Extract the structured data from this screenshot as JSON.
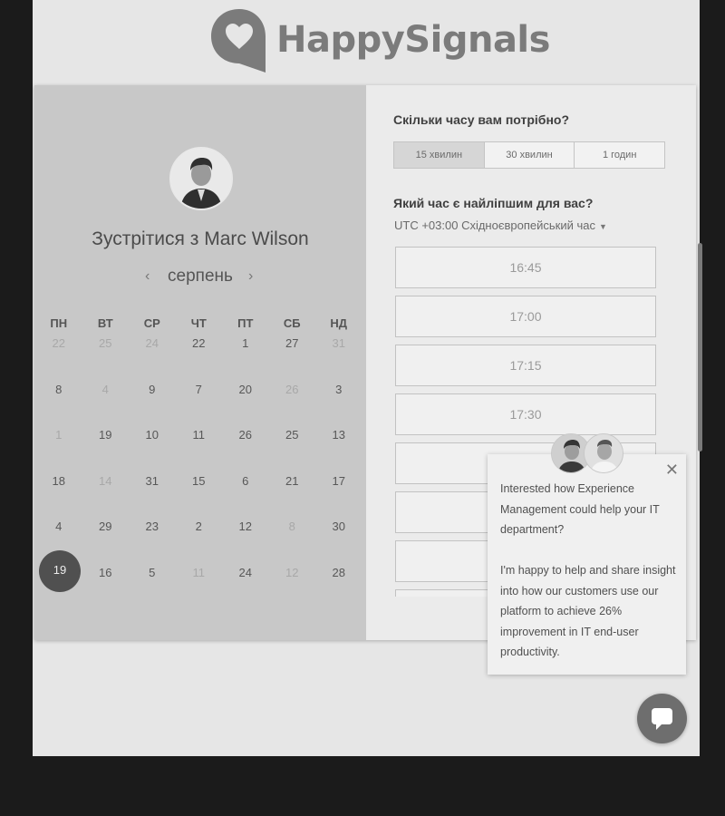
{
  "brand": {
    "name": "HappySignals",
    "icon": "heart-speech-bubble-icon"
  },
  "booking": {
    "title": "Зустрітися з Marc Wilson",
    "month": "серпень",
    "weekdays": [
      "ПН",
      "ВТ",
      "СР",
      "ЧТ",
      "ПТ",
      "СБ",
      "НД"
    ],
    "days": [
      [
        {
          "v": "22",
          "m": true
        },
        {
          "v": "25",
          "m": true
        },
        {
          "v": "24",
          "m": true
        },
        {
          "v": "22",
          "m": false
        },
        {
          "v": "1",
          "m": false
        },
        {
          "v": "27",
          "m": false
        },
        {
          "v": "31",
          "m": true
        }
      ],
      [
        {
          "v": "8",
          "m": false
        },
        {
          "v": "4",
          "m": true
        },
        {
          "v": "9",
          "m": false
        },
        {
          "v": "7",
          "m": false
        },
        {
          "v": "20",
          "m": false
        },
        {
          "v": "26",
          "m": true
        },
        {
          "v": "3",
          "m": false
        }
      ],
      [
        {
          "v": "1",
          "m": true
        },
        {
          "v": "19",
          "m": false
        },
        {
          "v": "10",
          "m": false
        },
        {
          "v": "11",
          "m": false
        },
        {
          "v": "26",
          "m": false
        },
        {
          "v": "25",
          "m": false
        },
        {
          "v": "13",
          "m": false
        }
      ],
      [
        {
          "v": "18",
          "m": false
        },
        {
          "v": "14",
          "m": true
        },
        {
          "v": "31",
          "m": false
        },
        {
          "v": "15",
          "m": false
        },
        {
          "v": "6",
          "m": false
        },
        {
          "v": "21",
          "m": false
        },
        {
          "v": "17",
          "m": false
        }
      ],
      [
        {
          "v": "4",
          "m": false
        },
        {
          "v": "29",
          "m": false
        },
        {
          "v": "23",
          "m": false
        },
        {
          "v": "2",
          "m": false
        },
        {
          "v": "12",
          "m": false
        },
        {
          "v": "8",
          "m": true
        },
        {
          "v": "30",
          "m": false
        }
      ],
      [
        {
          "v": "19",
          "m": false
        },
        {
          "v": "16",
          "m": false
        },
        {
          "v": "5",
          "m": false
        },
        {
          "v": "11",
          "m": true
        },
        {
          "v": "24",
          "m": false
        },
        {
          "v": "12",
          "m": true
        },
        {
          "v": "28",
          "m": false
        }
      ]
    ],
    "selected_day": "19",
    "duration_question": "Скільки часу вам потрібно?",
    "durations": [
      "15 хвилин",
      "30 хвилин",
      "1 годин"
    ],
    "active_duration": "15 хвилин",
    "time_question": "Який час є найліпшим для вас?",
    "timezone": "UTC +03:00 Східноєвропейський час",
    "slots": [
      "16:45",
      "17:00",
      "17:15",
      "17:30",
      "",
      "",
      "",
      ""
    ]
  },
  "chat_popup": {
    "paragraph1": "Interested how Experience Management could help your IT department?",
    "paragraph2": "I'm happy to help and share insight into how our customers use our platform to achieve 26% improvement in IT end-user productivity."
  }
}
